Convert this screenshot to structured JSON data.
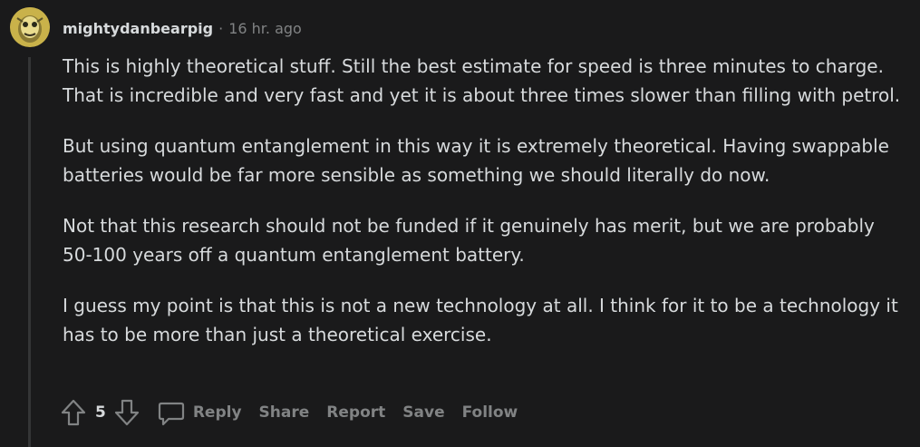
{
  "comment": {
    "author": "mightydanbearpig",
    "separator": "·",
    "timestamp": "16 hr. ago",
    "avatar_icon": "avatar-icon",
    "paragraphs": [
      "This is highly theoretical stuff. Still the best estimate for speed is three minutes to charge. That is incredible and very fast and yet it is about three times slower than filling with petrol.",
      "But using quantum entanglement in this way it is extremely theoretical. Having swappable batteries would be far more sensible as something we should literally do now.",
      "Not that this research should not be funded if it genuinely has merit, but we are probably 50-100 years off a quantum entanglement battery.",
      "I guess my point is that this is not a new technology at all. I think for it to be a technology it has to be more than just a theoretical exercise."
    ]
  },
  "actions": {
    "upvote_icon": "upvote-icon",
    "score": "5",
    "downvote_icon": "downvote-icon",
    "reply_icon": "comment-bubble-icon",
    "reply_label": "Reply",
    "share_label": "Share",
    "report_label": "Report",
    "save_label": "Save",
    "follow_label": "Follow"
  },
  "colors": {
    "background": "#1a1a1b",
    "text": "#d7dadc",
    "muted": "#818384",
    "thread_line": "#343536"
  }
}
